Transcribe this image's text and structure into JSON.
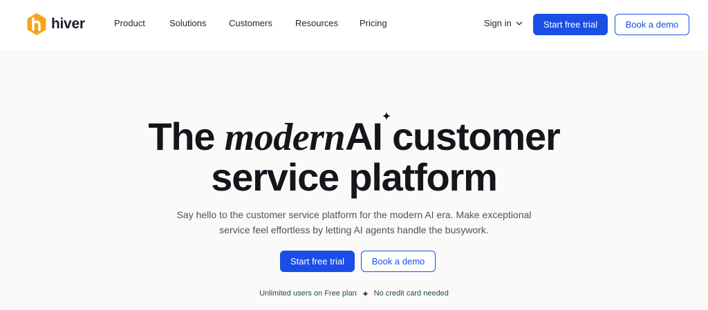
{
  "brand": {
    "name": "hiver",
    "logo_color": "#f5a51c",
    "logo_icon": "hiver-hexagon-logo"
  },
  "nav": {
    "items": [
      {
        "label": "Product"
      },
      {
        "label": "Solutions"
      },
      {
        "label": "Customers"
      },
      {
        "label": "Resources"
      },
      {
        "label": "Pricing"
      }
    ],
    "sign_in": "Sign in",
    "sign_in_icon": "chevron-down-icon",
    "start_trial": "Start free trial",
    "book_demo": "Book a demo"
  },
  "hero": {
    "title_part1": "The ",
    "title_italic": "modern",
    "title_ai": " AI",
    "title_part2": " customer",
    "title_line2": "service platform",
    "subtitle_line1": "Say hello to the customer service platform for the modern AI era. Make exceptional",
    "subtitle_line2": "service feel effortless by letting AI agents handle the busywork.",
    "cta_primary": "Start free trial",
    "cta_secondary": "Book a demo",
    "note_left": "Unlimited users on Free plan",
    "note_right": "No credit card needed",
    "note_separator_icon": "sparkle-icon"
  },
  "colors": {
    "accent": "#1a4ee6",
    "note_text": "#1e4d4a",
    "hero_bg": "#fbfaf8"
  }
}
